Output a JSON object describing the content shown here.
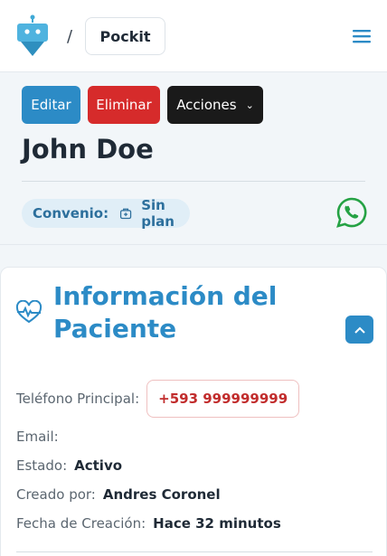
{
  "header": {
    "separator": "/",
    "brand_label": "Pockit",
    "menu_icon": "hamburger-icon",
    "logo_icon": "robot-logo"
  },
  "actions": {
    "edit_label": "Editar",
    "delete_label": "Eliminar",
    "actions_label": "Acciones"
  },
  "patient": {
    "name": "John Doe",
    "plan_label": "Convenio:",
    "plan_value": "Sin plan"
  },
  "info_card": {
    "title": "Información del Paciente",
    "fields": {
      "phone_label": "Teléfono Principal:",
      "phone_value": "+593 999999999",
      "email_label": "Email:",
      "email_value": "",
      "status_label": "Estado:",
      "status_value": "Activo",
      "created_by_label": "Creado por:",
      "created_by_value": "Andres Coronel",
      "created_date_label": "Fecha de Creación:",
      "created_date_value": "Hace 32 minutos"
    }
  },
  "colors": {
    "primary": "#2c8bc6",
    "danger": "#d62b2b",
    "dark": "#1a1a1a",
    "whatsapp": "#25a244"
  }
}
